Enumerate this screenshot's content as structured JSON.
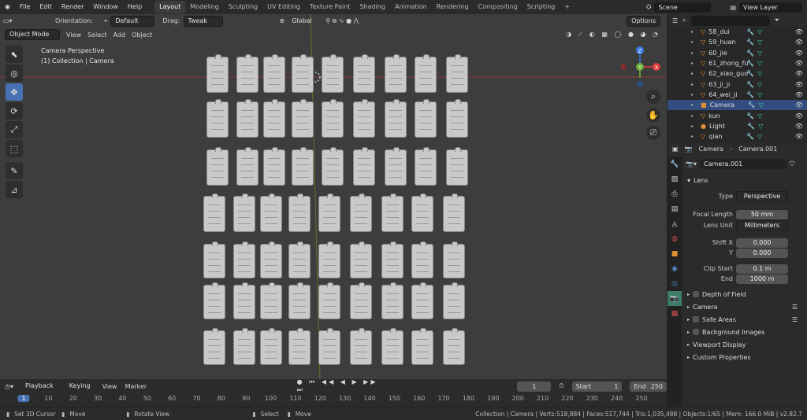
{
  "topbar": {
    "menus": [
      "File",
      "Edit",
      "Render",
      "Window",
      "Help"
    ],
    "workspaces": [
      "Layout",
      "Modeling",
      "Sculpting",
      "UV Editing",
      "Texture Paint",
      "Shading",
      "Animation",
      "Rendering",
      "Compositing",
      "Scripting"
    ],
    "scene": "Scene",
    "view_layer": "View Layer"
  },
  "vp_header": {
    "orientation_label": "Orientation:",
    "orientation": "Default",
    "drag_label": "Drag:",
    "drag": "Tweak",
    "transform": "Global",
    "options": "Options"
  },
  "vp_header2": {
    "mode": "Object Mode",
    "menus": [
      "View",
      "Select",
      "Add",
      "Object"
    ]
  },
  "viewport": {
    "line1": "Camera Perspective",
    "line2": "(1) Collection | Camera"
  },
  "gizmo": {
    "z": "Z",
    "y": "Y",
    "x": "X"
  },
  "outliner": {
    "items": [
      {
        "name": "58_dui",
        "type": "mesh"
      },
      {
        "name": "59_huan",
        "type": "mesh"
      },
      {
        "name": "60_jie",
        "type": "mesh"
      },
      {
        "name": "61_zhong_fu",
        "type": "mesh"
      },
      {
        "name": "62_xiao_guo",
        "type": "mesh"
      },
      {
        "name": "63_ji_ji",
        "type": "mesh"
      },
      {
        "name": "64_wei_ji",
        "type": "mesh"
      },
      {
        "name": "Camera",
        "type": "camera"
      },
      {
        "name": "kun",
        "type": "mesh"
      },
      {
        "name": "Light",
        "type": "light"
      },
      {
        "name": "qian",
        "type": "mesh"
      }
    ],
    "selected": "Camera"
  },
  "properties": {
    "object": "Camera",
    "data": "Camera.001",
    "datablock": "Camera.001",
    "panel": "Lens",
    "rows": [
      {
        "label": "Type",
        "value": "Perspective"
      },
      {
        "label": "Focal Length",
        "value": "50 mm"
      },
      {
        "label": "Lens Unit",
        "value": "Millimeters"
      },
      {
        "label": "Shift X",
        "value": "0.000"
      },
      {
        "label": "Y",
        "value": "0.000"
      },
      {
        "label": "Clip Start",
        "value": "0.1 m"
      },
      {
        "label": "End",
        "value": "1000 m"
      }
    ],
    "sections": [
      "Depth of Field",
      "Camera",
      "Safe Areas",
      "Background Images",
      "Viewport Display",
      "Custom Properties"
    ]
  },
  "timeline": {
    "menus": [
      "Playback",
      "Keying",
      "View",
      "Marker"
    ],
    "current": "1",
    "start_label": "Start",
    "start": "1",
    "end_label": "End",
    "end": "250",
    "ticks": [
      "1",
      "10",
      "20",
      "30",
      "40",
      "50",
      "60",
      "70",
      "80",
      "90",
      "100",
      "110",
      "120",
      "130",
      "140",
      "150",
      "160",
      "170",
      "180",
      "190",
      "200",
      "210",
      "220",
      "230",
      "240",
      "250"
    ]
  },
  "status": {
    "left": [
      "Set 3D Cursor",
      "Move",
      "Rotate View",
      "Select",
      "Move"
    ],
    "right": "Collection | Camera | Verts:518,884 | Faces:517,744 | Tris:1,035,488 | Objects:1/65 | Mem: 166.0 MiB | v2.82.7"
  },
  "colors": {
    "accent": "#4772b3",
    "selected_row": "#334d80",
    "gizmo_x": "#e03a3a",
    "gizmo_y": "#6bb03a",
    "gizmo_z": "#3a7be0"
  }
}
